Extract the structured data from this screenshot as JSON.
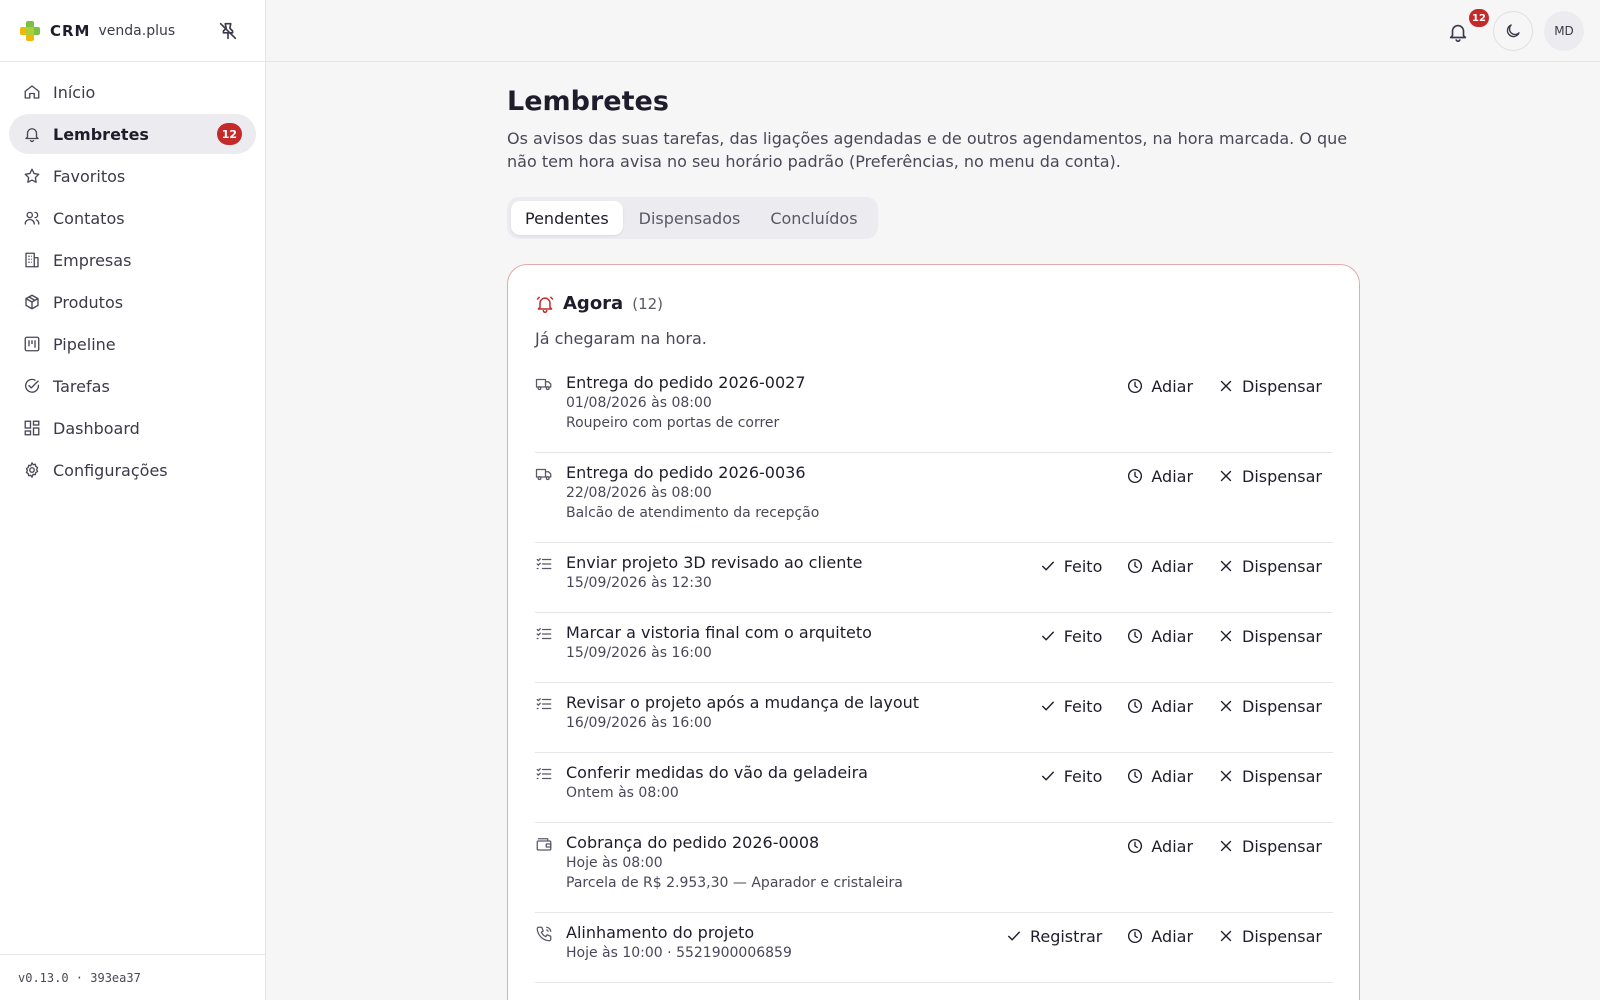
{
  "brand": {
    "crm": "CRM",
    "product": "venda.plus"
  },
  "nav": {
    "items": [
      {
        "id": "inicio",
        "label": "Início",
        "icon": "home-icon"
      },
      {
        "id": "lembretes",
        "label": "Lembretes",
        "icon": "bell-icon",
        "badge": "12",
        "active": true
      },
      {
        "id": "favoritos",
        "label": "Favoritos",
        "icon": "star-icon"
      },
      {
        "id": "contatos",
        "label": "Contatos",
        "icon": "users-icon"
      },
      {
        "id": "empresas",
        "label": "Empresas",
        "icon": "building-icon"
      },
      {
        "id": "produtos",
        "label": "Produtos",
        "icon": "package-icon"
      },
      {
        "id": "pipeline",
        "label": "Pipeline",
        "icon": "kanban-icon"
      },
      {
        "id": "tarefas",
        "label": "Tarefas",
        "icon": "check-circle-icon"
      },
      {
        "id": "dashboard",
        "label": "Dashboard",
        "icon": "dashboard-icon"
      },
      {
        "id": "configuracoes",
        "label": "Configurações",
        "icon": "gear-icon"
      }
    ]
  },
  "version": "v0.13.0 · 393ea37",
  "topbar": {
    "notifications_badge": "12",
    "avatar_initials": "MD"
  },
  "page": {
    "title": "Lembretes",
    "description": "Os avisos das suas tarefas, das ligações agendadas e de outros agendamentos, na hora marcada. O que não tem hora avisa no seu horário padrão (Preferências, no menu da conta).",
    "tabs": [
      {
        "label": "Pendentes",
        "active": true
      },
      {
        "label": "Dispensados"
      },
      {
        "label": "Concluídos"
      }
    ]
  },
  "panel": {
    "title": "Agora",
    "count": "(12)",
    "subtitle": "Já chegaram na hora.",
    "items": [
      {
        "icon": "truck-icon",
        "title": "Entrega do pedido 2026-0027",
        "when": "01/08/2026 às 08:00",
        "detail": "Roupeiro com portas de correr",
        "actions": [
          "Adiar",
          "Dispensar"
        ]
      },
      {
        "icon": "truck-icon",
        "title": "Entrega do pedido 2026-0036",
        "when": "22/08/2026 às 08:00",
        "detail": "Balcão de atendimento da recepção",
        "actions": [
          "Adiar",
          "Dispensar"
        ]
      },
      {
        "icon": "task-list-icon",
        "title": "Enviar projeto 3D revisado ao cliente",
        "when": "15/09/2026 às 12:30",
        "detail": "",
        "actions": [
          "Feito",
          "Adiar",
          "Dispensar"
        ]
      },
      {
        "icon": "task-list-icon",
        "title": "Marcar a vistoria final com o arquiteto",
        "when": "15/09/2026 às 16:00",
        "detail": "",
        "actions": [
          "Feito",
          "Adiar",
          "Dispensar"
        ]
      },
      {
        "icon": "task-list-icon",
        "title": "Revisar o projeto após a mudança de layout",
        "when": "16/09/2026 às 16:00",
        "detail": "",
        "actions": [
          "Feito",
          "Adiar",
          "Dispensar"
        ]
      },
      {
        "icon": "task-list-icon",
        "title": "Conferir medidas do vão da geladeira",
        "when": "Ontem às 08:00",
        "detail": "",
        "actions": [
          "Feito",
          "Adiar",
          "Dispensar"
        ]
      },
      {
        "icon": "wallet-icon",
        "title": "Cobrança do pedido 2026-0008",
        "when": "Hoje às 08:00",
        "detail": "Parcela de R$ 2.953,30 — Aparador e cristaleira",
        "actions": [
          "Adiar",
          "Dispensar"
        ]
      },
      {
        "icon": "phone-icon",
        "title": "Alinhamento do projeto",
        "when": "Hoje às 10:00 · 5521900006859",
        "detail": "",
        "actions": [
          "Registrar",
          "Adiar",
          "Dispensar"
        ]
      }
    ]
  },
  "colors": {
    "accent_red": "#c52a2a",
    "panel_border": "#e6a9ae",
    "logo_green": "#7bc043",
    "logo_yellow": "#f2b705"
  }
}
